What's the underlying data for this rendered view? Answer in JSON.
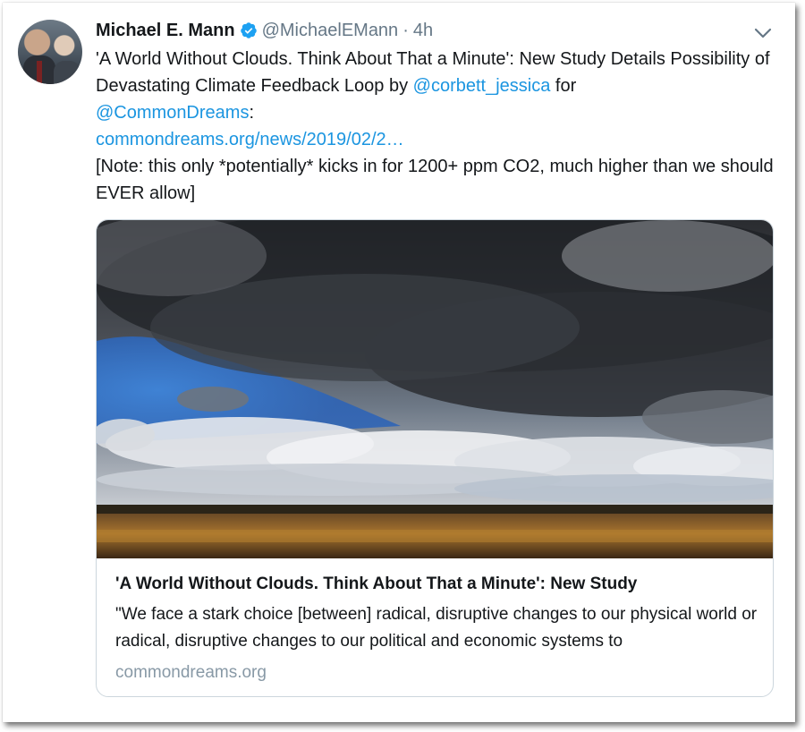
{
  "tweet": {
    "author": {
      "display_name": "Michael E. Mann",
      "verified_icon": "verified-badge-icon",
      "handle": "@MichaelEMann",
      "separator": "·",
      "timestamp": "4h"
    },
    "menu_icon": "chevron-down-icon",
    "text": {
      "part1": "'A World Without Clouds. Think About That a Minute': New Study Details Possibility of Devastating Climate Feedback Loop by ",
      "mention1": "@corbett_jessica",
      "part2": " for ",
      "mention2": "@CommonDreams",
      "part3": ":",
      "url": "commondreams.org/news/2019/02/2…",
      "note": "[Note: this only *potentially* kicks in for 1200+ ppm CO2, much higher than we should EVER allow]"
    },
    "card": {
      "image_description_icon": "cloudy-landscape-photo",
      "title": "'A World Without Clouds. Think About That a Minute': New Study",
      "description": "\"We face a stark choice [between] radical, disruptive changes to our physical world or radical, disruptive changes to our political and economic systems to",
      "domain": "commondreams.org"
    }
  },
  "colors": {
    "link": "#1b95e0",
    "text": "#14171a",
    "muted": "#657786",
    "verified": "#1da1f2",
    "card_border": "#ccd6dd"
  }
}
